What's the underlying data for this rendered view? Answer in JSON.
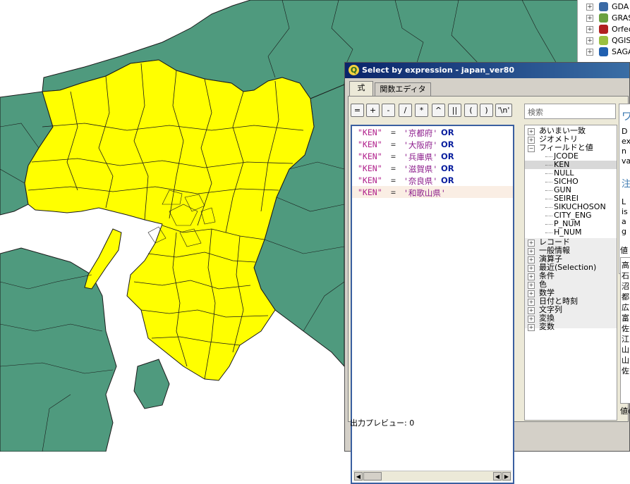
{
  "toolbox": {
    "items": [
      {
        "label": "GDA",
        "expand": "+",
        "icon": "gdal-icon",
        "color": "#3a6aa5"
      },
      {
        "label": "GRASS",
        "expand": "+",
        "icon": "grass-icon",
        "color": "#6aa040"
      },
      {
        "label": "Orfeo",
        "expand": "+",
        "icon": "orfeo-icon",
        "color": "#b02020"
      },
      {
        "label": "QGIS",
        "expand": "+",
        "icon": "qgis-icon",
        "color": "#9ac040"
      },
      {
        "label": "SAGA",
        "expand": "+",
        "icon": "saga-icon",
        "color": "#2060b0"
      }
    ]
  },
  "dialog": {
    "title": "Select by expression - japan_ver80",
    "tabs": [
      "式",
      "関数エディタ"
    ],
    "operators": [
      "=",
      "+",
      "-",
      "/",
      "*",
      "^",
      "||",
      "(",
      ")",
      "'\\n'"
    ],
    "expression_lines": [
      {
        "field": "\"KEN\"",
        "eq": "=",
        "value": "'京都府'",
        "op": "OR"
      },
      {
        "field": "\"KEN\"",
        "eq": "=",
        "value": "'大阪府'",
        "op": "OR"
      },
      {
        "field": "\"KEN\"",
        "eq": "=",
        "value": "'兵庫県'",
        "op": "OR"
      },
      {
        "field": "\"KEN\"",
        "eq": "=",
        "value": "'滋賀県'",
        "op": "OR"
      },
      {
        "field": "\"KEN\"",
        "eq": "=",
        "value": "'奈良県'",
        "op": "OR"
      },
      {
        "field": "\"KEN\"",
        "eq": "=",
        "value": "'和歌山県'",
        "op": ""
      }
    ],
    "search_placeholder": "検索",
    "tree_top": [
      {
        "expand": "+",
        "label": "あいまい一致"
      },
      {
        "expand": "+",
        "label": "ジオメトリ"
      },
      {
        "expand": "−",
        "label": "フィールドと値"
      }
    ],
    "fields": [
      "JCODE",
      "KEN",
      "NULL",
      "SICHO",
      "GUN",
      "SEIREI",
      "SIKUCHOSON",
      "CITY_ENG",
      "P_NUM",
      "H_NUM"
    ],
    "selected_field": "KEN",
    "tree_bottom": [
      {
        "expand": "+",
        "label": "レコード"
      },
      {
        "expand": "+",
        "label": "一般情報"
      },
      {
        "expand": "+",
        "label": "演算子"
      },
      {
        "expand": "+",
        "label": "最近(Selection)"
      },
      {
        "expand": "+",
        "label": "条件"
      },
      {
        "expand": "+",
        "label": "色"
      },
      {
        "expand": "+",
        "label": "数学"
      },
      {
        "expand": "+",
        "label": "日付と時刻"
      },
      {
        "expand": "+",
        "label": "文字列"
      },
      {
        "expand": "+",
        "label": "変換"
      },
      {
        "expand": "+",
        "label": "変数"
      }
    ],
    "help_fragments": {
      "heading": "ワ",
      "body": [
        "D",
        "ex",
        "n",
        "va"
      ],
      "note_heading": "注",
      "note_body": [
        "L",
        "is",
        "a",
        "g"
      ]
    },
    "values_label": "値",
    "values_items": [
      "高",
      "石",
      "沼",
      "都",
      "広",
      "富",
      "佐",
      "江",
      "山",
      "山",
      "佐"
    ],
    "values_bottom": "値の",
    "preview": "出力プレビュー: 0"
  },
  "colors": {
    "selected": "#ffff00",
    "other": "#4f9a7e",
    "border": "#1a1a1a"
  }
}
